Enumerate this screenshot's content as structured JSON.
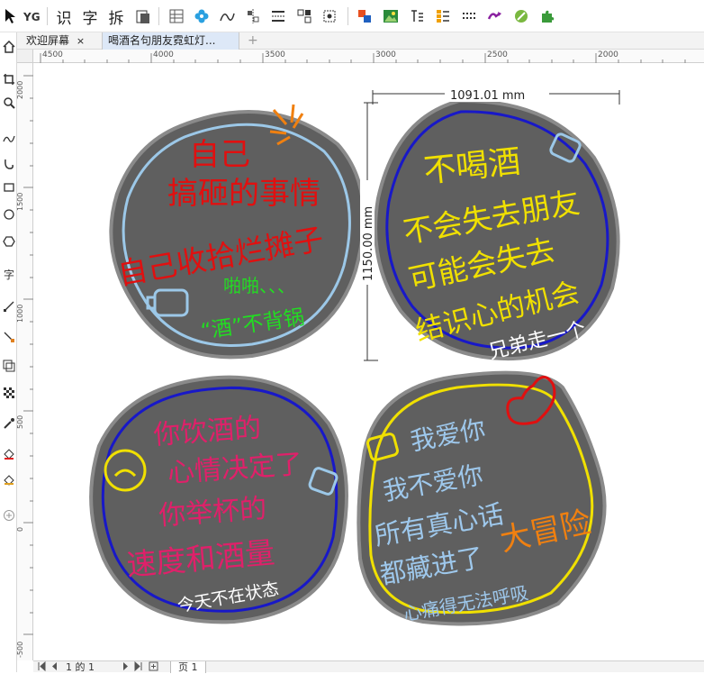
{
  "toolbar": {
    "text_buttons": [
      "识",
      "字",
      "拆"
    ]
  },
  "tabs": {
    "welcome": "欢迎屏幕",
    "welcome_close": "×",
    "document": "喝酒名句朋友霓虹灯...",
    "add": "+"
  },
  "ruler": {
    "h_ticks": [
      "4500",
      "4000",
      "3500",
      "3000",
      "2500",
      "2000"
    ],
    "v_ticks": [
      "2000",
      "1500",
      "1000",
      "500",
      "0",
      "-500"
    ]
  },
  "dimensions": {
    "width_label": "1091.01 mm",
    "height_label": "1150.00 mm"
  },
  "signs": {
    "top_left": {
      "line1": "自己",
      "line2": "搞砸的事情",
      "line3": "自己收拾烂摊子",
      "line4": "啪啪、、、",
      "line5": "“酒”不背锅",
      "colors": {
        "main": "#e01010",
        "accent": "#22dd22",
        "outline": "#9cc8e8"
      }
    },
    "top_right": {
      "line1": "不喝酒",
      "line2": "不会失去朋友",
      "line3": "可能会失去",
      "line4": "结识心的机会",
      "line5": "兄弟走一个",
      "colors": {
        "main": "#f0e000",
        "accent": "#ffffff",
        "outline": "#1818c8"
      }
    },
    "bottom_left": {
      "line1": "你饮酒的",
      "line2": "心情决定了",
      "line3": "你举杯的",
      "line4": "速度和酒量",
      "line5": "今天不在状态",
      "colors": {
        "main": "#e0206a",
        "accent": "#ffffff",
        "outline": "#1818c8",
        "face": "#f0e000"
      }
    },
    "bottom_right": {
      "line1": "我爱你",
      "line2": "我不爱你",
      "line3": "所有真心话",
      "line4": "都藏进了",
      "line5": "大冒险",
      "line6": "心痛得无法呼吸",
      "colors": {
        "main": "#9ec8ec",
        "accent": "#f08010",
        "outline": "#f0e000",
        "heart": "#e01010"
      }
    }
  },
  "pagebar": {
    "page_of": "1 的 1",
    "page_tab": "页 1"
  },
  "colors": {
    "sign_fill": "#5f5f5f",
    "sign_border": "#8a8a8a"
  }
}
